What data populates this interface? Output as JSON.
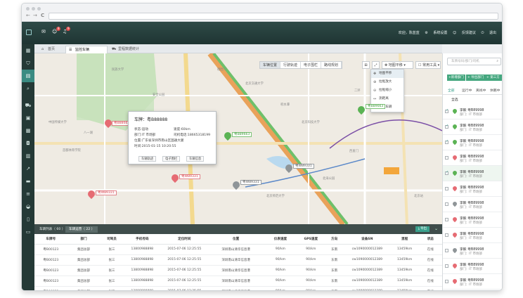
{
  "chrome": {
    "back": "←",
    "forward": "→",
    "reload": "C"
  },
  "topbar": {
    "badges": [
      "8",
      "9"
    ],
    "welcome": "欢迎，陈蓝蓝",
    "settings": "系统设置",
    "feedback": "反馈建议",
    "logout": "退出"
  },
  "tabs": [
    {
      "label": "首页"
    },
    {
      "label": "监控车辆"
    },
    {
      "label": "里程数据统计"
    }
  ],
  "map": {
    "tools": [
      "车辆位置",
      "行驶轨迹",
      "电子围栏",
      "路线规划"
    ],
    "layer_select": "地图平移",
    "toolbox": "常用工具",
    "menu": [
      {
        "icon": "✥",
        "label": "地图平移"
      },
      {
        "icon": "⊕",
        "label": "拉框放大"
      },
      {
        "icon": "⊖",
        "label": "拉框缩小"
      },
      {
        "icon": "↔",
        "label": "测距离"
      },
      {
        "icon": "☐",
        "label": "框选车辆"
      }
    ],
    "popup": {
      "plate": "车牌：粤B88888",
      "status": "状态:运动",
      "speed": "速度:60km",
      "dept": "部门:IT 市场部",
      "driver_phone": "司机电话:18665318199",
      "address": "位置:广东省深圳市南山区国通大厦",
      "time": "时间:2015-01-15 10:20:55",
      "buttons": [
        "车辆轨迹",
        "电子围栏",
        "车辆信息"
      ]
    },
    "vehicles": [
      {
        "label": "粤B88663",
        "color": "r"
      },
      {
        "label": "粤B89663",
        "color": "g"
      },
      {
        "label": "粤B89663",
        "color": "g"
      },
      {
        "label": "粤W89331",
        "color": "r"
      },
      {
        "label": "粤W89331",
        "color": "r"
      },
      {
        "label": "粤W89331",
        "color": "gr"
      },
      {
        "label": "粤W89331",
        "color": "gr"
      }
    ],
    "places": [
      "安全公园",
      "中国传媒大学",
      "北京交通大学",
      "民族大学",
      "北京师范大学",
      "首都体育学院",
      "八一湖",
      "二环",
      "西直门",
      "北京科技大学",
      "北海公园",
      "北京站",
      "德胜门",
      "积水潭"
    ]
  },
  "list": {
    "tab1": "车辆列表（ 60 ）",
    "tab2": "车辆运营（ 22 ）",
    "export": "导出",
    "columns": [
      "车牌号",
      "部门",
      "司驾员",
      "手机号码",
      "定位时间",
      "位置",
      "仪表速度",
      "GPS速度",
      "方向",
      "设备SN",
      "里程",
      "状态"
    ],
    "rows": [
      [
        "粤B00123",
        "集团总部",
        "张三",
        "13800988898",
        "2015-07-06 12:25:55",
        "深圳南山清华信息港",
        "90/km",
        "90/km",
        "东南",
        "cw1090000012389",
        "13459km",
        "在线"
      ],
      [
        "粤B00123",
        "集团总部",
        "张三",
        "13800988898",
        "2015-07-06 12:25:55",
        "深圳南山清华信息港",
        "90/km",
        "90/km",
        "东南",
        "cw1090000012389",
        "13459km",
        "在线"
      ],
      [
        "粤B00123",
        "集团总部",
        "张三",
        "13800988898",
        "2015-07-06 12:25:55",
        "深圳南山清华信息港",
        "90/km",
        "90/km",
        "东南",
        "cw1090000012389",
        "13459km",
        "在线"
      ],
      [
        "粤B00123",
        "集团总部",
        "张三",
        "13800988898",
        "2015-07-06 12:25:55",
        "深圳南山清华信息港",
        "90/km",
        "90/km",
        "东南",
        "cw1090000012389",
        "13459km",
        "在线"
      ],
      [
        "粤B00123",
        "集团总部",
        "张三",
        "13800988898",
        "2015-07-06 12:25:55",
        "深圳南山清华信息港",
        "90/km",
        "90/km",
        "东南",
        "cw1090000012389",
        "13459km",
        "在线"
      ]
    ]
  },
  "panel": {
    "search_placeholder": "车牌号码/部门/司机",
    "buttons": [
      "+新增部门",
      "+ 导出部门",
      "+ 第三方管理"
    ],
    "filter_tabs": [
      "全部",
      "运行中",
      "离线中",
      "休眠中"
    ],
    "select_all": "全选",
    "vehicles": [
      {
        "name": "李毅 粤B89998",
        "dept": "部门：IT 市场部",
        "color": "#5bb354",
        "checked": true
      },
      {
        "name": "李毅 粤B89998",
        "dept": "部门：IT 市场部",
        "color": "#5bb354",
        "checked": true
      },
      {
        "name": "李毅 粤B89998",
        "dept": "部门：IT 市场部",
        "color": "#5bb354",
        "checked": true
      },
      {
        "name": "李毅 粤B89998",
        "dept": "部门：IT 市场部",
        "color": "#e66b73",
        "checked": false
      },
      {
        "name": "李毅 粤B89998",
        "dept": "部门：IT 市场部",
        "color": "#5bb354",
        "checked": true
      },
      {
        "name": "李毅 粤B89998",
        "dept": "部门：IT 市场部",
        "color": "#e66b73",
        "checked": false
      },
      {
        "name": "李毅 粤B89998",
        "dept": "部门：IT 市场部",
        "color": "#8f9598",
        "checked": false
      },
      {
        "name": "李毅 粤B89998",
        "dept": "部门：IT 市场部",
        "color": "#e66b73",
        "checked": false
      },
      {
        "name": "李毅 粤B89998",
        "dept": "部门：IT 市场部",
        "color": "#e66b73",
        "checked": false
      },
      {
        "name": "李毅 粤B89998",
        "dept": "部门：IT 市场部",
        "color": "#8f9598",
        "checked": false
      },
      {
        "name": "李毅 粤B89998",
        "dept": "部门：IT 市场部",
        "color": "#e66b73",
        "checked": false
      },
      {
        "name": "李毅 粤B89998",
        "dept": "部门：IT 市场部",
        "color": "#e66b73",
        "checked": false
      }
    ]
  },
  "colors": {
    "accent": "#3aa18d",
    "topbar": "#2e4a47",
    "sidebar": "#243936"
  }
}
